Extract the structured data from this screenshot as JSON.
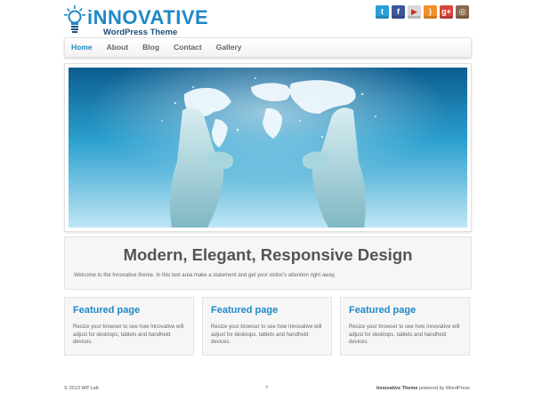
{
  "header": {
    "logo_title": "iNNOVATIVE",
    "logo_subtitle": "WordPress Theme",
    "social_icons": [
      {
        "name": "twitter-icon",
        "glyph": "t",
        "color": "#2a9fd8"
      },
      {
        "name": "facebook-icon",
        "glyph": "f",
        "color": "#3b5998"
      },
      {
        "name": "youtube-icon",
        "glyph": "▶",
        "color": "#d9d9d9"
      },
      {
        "name": "rss-icon",
        "glyph": ")",
        "color": "#f4902a"
      },
      {
        "name": "google-plus-icon",
        "glyph": "g+",
        "color": "#d8463b"
      },
      {
        "name": "instagram-icon",
        "glyph": "◎",
        "color": "#8a6a52"
      }
    ]
  },
  "nav": {
    "items": [
      "Home",
      "About",
      "Blog",
      "Contact",
      "Gallery"
    ],
    "active": "Home"
  },
  "intro": {
    "heading": "Modern, Elegant, Responsive Design",
    "text": "Welcome to the Innovative theme. In this text area make a statement and get your visitor's attention right away."
  },
  "features": [
    {
      "title": "Featured page",
      "text": "Resize your browser to see how Innovative will adjust for desktops, tablets and handheld devices."
    },
    {
      "title": "Featured page",
      "text": "Resize your browser to see how Innovative will adjust for desktops, tablets and handheld devices."
    },
    {
      "title": "Featured page",
      "text": "Resize your browser to see how Innovative will adjust for desktops, tablets and handheld devices."
    }
  ],
  "footer": {
    "copyright": "© 2013 WP Lab",
    "center": "?",
    "theme_name": "Innovative Theme",
    "powered_by": "powered by WordPress"
  },
  "colors": {
    "accent": "#1e88c8",
    "box_bg": "#f6f6f6"
  }
}
